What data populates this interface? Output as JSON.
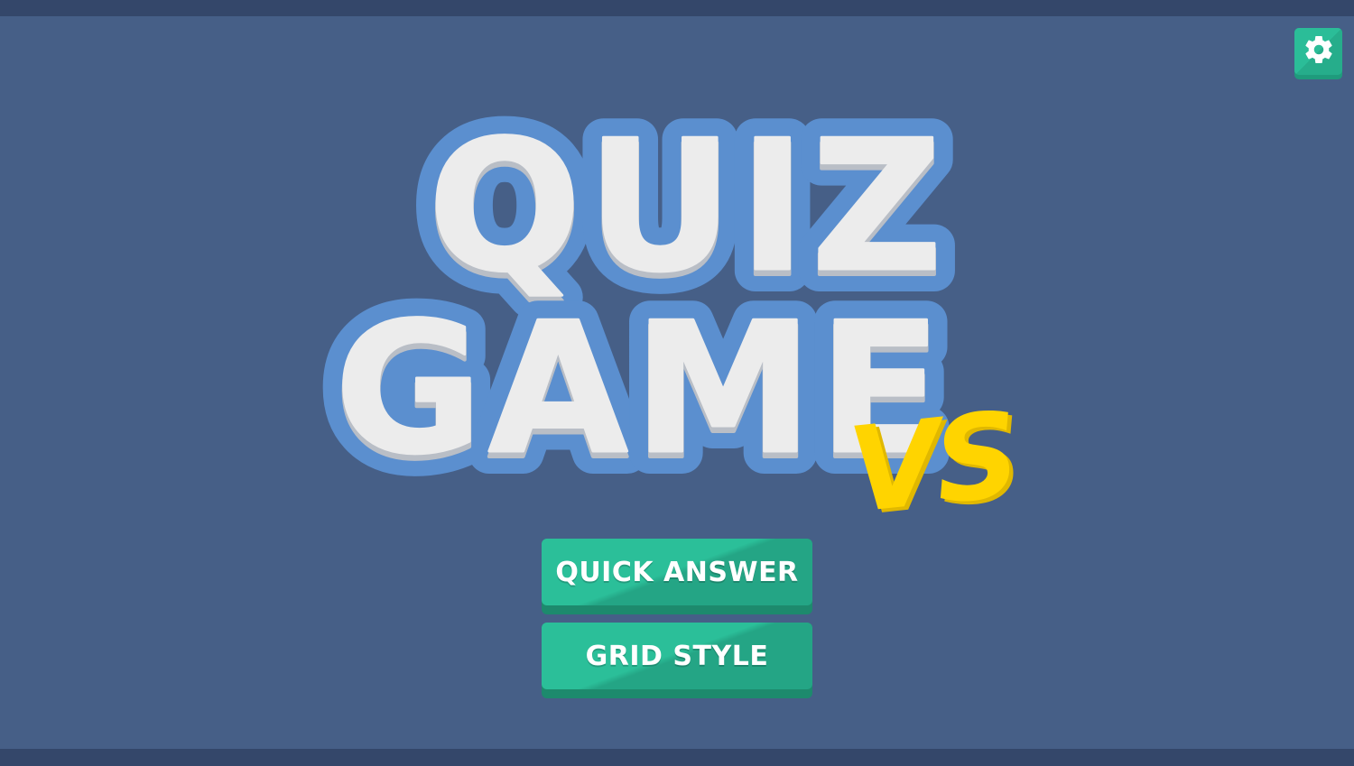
{
  "title": {
    "line1": "QUIZ",
    "line2": "GAME",
    "badge": "VS"
  },
  "menu": {
    "quick_answer_label": "QUICK ANSWER",
    "grid_style_label": "GRID STYLE"
  },
  "settings": {
    "icon": "gear-icon"
  },
  "colors": {
    "background": "#465f87",
    "frame_bars": "#34476a",
    "button_green": "#2bbf99",
    "button_green_dark": "#24a585",
    "logo_outline": "#5b8fcf",
    "logo_letters": "#ececec",
    "vs_yellow": "#ffd400"
  }
}
